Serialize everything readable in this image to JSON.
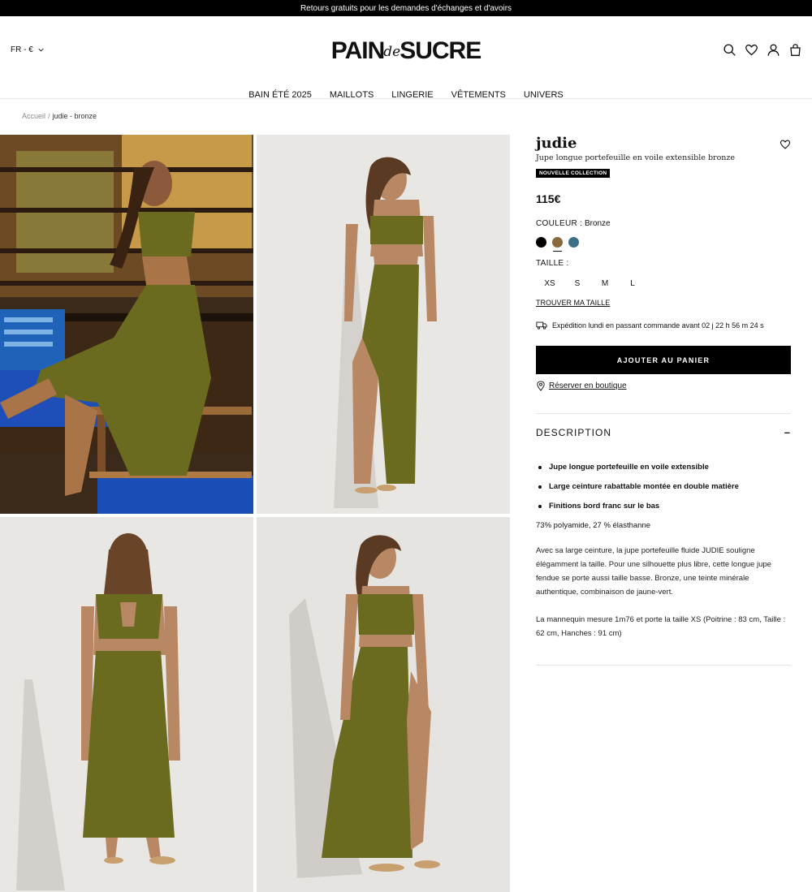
{
  "topbar": {
    "text": "Retours gratuits pour les demandes d'échanges et d'avoirs"
  },
  "header": {
    "lang": "FR - €",
    "logo_left": "PAIN",
    "logo_mid": "de",
    "logo_right": "SUCRE",
    "icons": [
      "search-icon",
      "heart-icon",
      "user-icon",
      "bag-icon"
    ]
  },
  "nav": {
    "items": [
      "BAIN ÉTÉ 2025",
      "MAILLOTS",
      "LINGERIE",
      "VÊTEMENTS",
      "UNIVERS"
    ]
  },
  "breadcrumb": {
    "home": "Accueil",
    "sep": "/",
    "current": "judie - bronze"
  },
  "product": {
    "name": "judie",
    "subtitle": "Jupe longue portefeuille en voile extensible bronze",
    "badge": "NOUVELLE COLLECTION",
    "price": "115€",
    "color_label": "COULEUR :",
    "color_value": "Bronze",
    "swatches": [
      {
        "name": "Noir",
        "color": "#000000"
      },
      {
        "name": "Bronze",
        "color": "#8a6a3b",
        "selected": true
      },
      {
        "name": "Bleu",
        "color": "#3d6f86"
      }
    ],
    "size_label": "TAILLE :",
    "sizes": [
      "XS",
      "S",
      "M",
      "L"
    ],
    "find_size": "TROUVER MA TAILLE",
    "shipping": "Expédition lundi en passant commande avant 02 j  22 h  56 m  24 s",
    "add_to_cart": "AJOUTER AU PANIER",
    "reserve": "Réserver en boutique"
  },
  "description": {
    "title": "DESCRIPTION",
    "toggle": "–",
    "bullets": [
      "Jupe longue portefeuille en voile extensible",
      "Large ceinture rabattable montée en double matière",
      "Finitions bord franc sur le bas"
    ],
    "composition": "73% polyamide, 27 % élasthanne",
    "paragraph1": "Avec sa large ceinture, la jupe portefeuille fluide JUDIE souligne élégamment la taille. Pour une silhouette plus libre, cette longue jupe fendue se porte aussi taille basse. Bronze, une teinte minérale authentique, combinaison de jaune-vert.",
    "paragraph2": "La mannequin mesure 1m76 et porte la taille XS (Poitrine : 83 cm, Taille : 62 cm, Hanches : 91 cm)"
  },
  "colors": {
    "olive": "#6b6b1f",
    "bg_studio": "#e8e6e3",
    "black": "#000000"
  }
}
